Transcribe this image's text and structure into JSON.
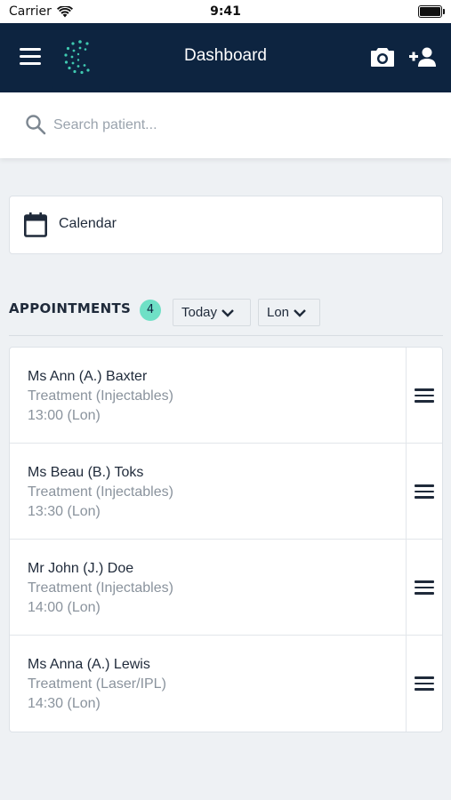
{
  "status_bar": {
    "carrier": "Carrier",
    "time": "9:41"
  },
  "nav": {
    "title": "Dashboard",
    "menu_icon": "hamburger-menu-icon",
    "logo_icon": "dotted-c-logo",
    "camera_icon": "camera-icon",
    "add_user_icon": "add-user-icon"
  },
  "search": {
    "placeholder": "Search patient...",
    "value": ""
  },
  "calendar": {
    "label": "Calendar",
    "icon": "calendar-icon"
  },
  "appointments": {
    "title": "APPOINTMENTS",
    "count": "4",
    "filter_day": "Today",
    "filter_location": "Lon",
    "items": [
      {
        "name": "Ms Ann (A.) Baxter",
        "type": "Treatment (Injectables)",
        "time": "13:00 (Lon)"
      },
      {
        "name": "Ms Beau (B.) Toks",
        "type": "Treatment (Injectables)",
        "time": "13:30 (Lon)"
      },
      {
        "name": "Mr John (J.) Doe",
        "type": "Treatment (Injectables)",
        "time": "14:00 (Lon)"
      },
      {
        "name": "Ms Anna (A.) Lewis",
        "type": "Treatment (Laser/IPL)",
        "time": "14:30 (Lon)"
      }
    ]
  },
  "colors": {
    "nav_background": "#0d2440",
    "accent_teal": "#6fe0c6",
    "page_background": "#eef1f4",
    "muted_text": "#8a939d"
  }
}
